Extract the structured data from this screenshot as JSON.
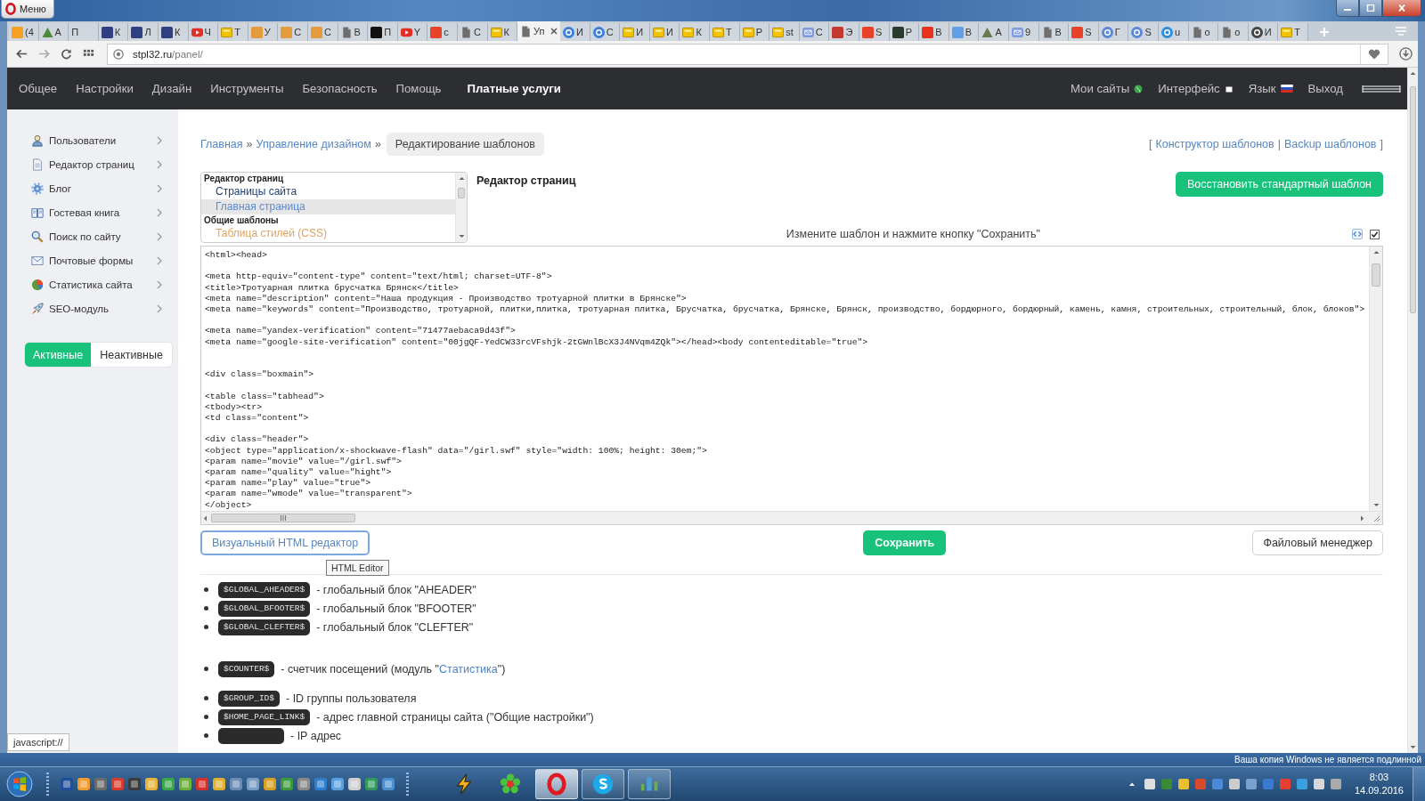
{
  "desktop": {
    "menu_button": "Меню",
    "notice": "Ваша копия Windows не является подлинной"
  },
  "browser": {
    "tabs": [
      {
        "title": "(4",
        "kind": "tile",
        "color": "#f5a021",
        "selected": false
      },
      {
        "title": "А",
        "kind": "triangle",
        "color": "#4f8a3c",
        "selected": false
      },
      {
        "title": "П",
        "kind": "none",
        "selected": false
      },
      {
        "title": "К",
        "kind": "tile",
        "color": "#2f3f7f",
        "selected": false
      },
      {
        "title": "Л",
        "kind": "tile",
        "color": "#2f3f7f",
        "selected": false
      },
      {
        "title": "К",
        "kind": "tile",
        "color": "#2f3f7f",
        "selected": false
      },
      {
        "title": "Ч",
        "kind": "play",
        "selected": false
      },
      {
        "title": "Т",
        "kind": "note",
        "selected": false
      },
      {
        "title": "У",
        "kind": "tile",
        "color": "#e39b3d",
        "selected": false
      },
      {
        "title": "С",
        "kind": "tile",
        "color": "#e39b3d",
        "selected": false
      },
      {
        "title": "С",
        "kind": "tile",
        "color": "#e39b3d",
        "selected": false
      },
      {
        "title": "В",
        "kind": "doc",
        "selected": false
      },
      {
        "title": "П",
        "kind": "tile",
        "color": "#111111",
        "selected": false
      },
      {
        "title": "Y",
        "kind": "play",
        "selected": false
      },
      {
        "title": "с",
        "kind": "tile",
        "color": "#e8412c",
        "selected": false
      },
      {
        "title": "С",
        "kind": "doc",
        "selected": false
      },
      {
        "title": "К",
        "kind": "note",
        "selected": false
      },
      {
        "title": "Уп",
        "kind": "doc",
        "selected": true
      },
      {
        "title": "И",
        "kind": "circle",
        "color": "#3d7fdb",
        "selected": false
      },
      {
        "title": "С",
        "kind": "circle",
        "color": "#3d7fdb",
        "selected": false
      },
      {
        "title": "И",
        "kind": "note",
        "selected": false
      },
      {
        "title": "И",
        "kind": "note",
        "selected": false
      },
      {
        "title": "К",
        "kind": "note",
        "selected": false
      },
      {
        "title": "Т",
        "kind": "note",
        "selected": false
      },
      {
        "title": "Р",
        "kind": "note",
        "selected": false
      },
      {
        "title": "st",
        "kind": "note",
        "selected": false
      },
      {
        "title": "С",
        "kind": "mail",
        "selected": false
      },
      {
        "title": "Э",
        "kind": "tile",
        "color": "#c43a2e",
        "selected": false
      },
      {
        "title": "S",
        "kind": "tile",
        "color": "#e8412c",
        "selected": false
      },
      {
        "title": "Р",
        "kind": "tile",
        "color": "#2b3a30",
        "selected": false
      },
      {
        "title": "В",
        "kind": "tile",
        "color": "#e8321e",
        "selected": false
      },
      {
        "title": "В",
        "kind": "tile",
        "color": "#5fa0e8",
        "selected": false
      },
      {
        "title": "А",
        "kind": "triangle",
        "color": "#6a7a50",
        "selected": false
      },
      {
        "title": "9",
        "kind": "mail",
        "selected": false
      },
      {
        "title": "В",
        "kind": "doc",
        "selected": false
      },
      {
        "title": "S",
        "kind": "tile",
        "color": "#e8412c",
        "selected": false
      },
      {
        "title": "Г",
        "kind": "circle",
        "color": "#5b87d8",
        "selected": false
      },
      {
        "title": "S",
        "kind": "circle",
        "color": "#5b87d8",
        "selected": false
      },
      {
        "title": "u",
        "kind": "circle",
        "color": "#2b8fe0",
        "selected": false
      },
      {
        "title": "о",
        "kind": "doc",
        "selected": false
      },
      {
        "title": "о",
        "kind": "doc",
        "selected": false
      },
      {
        "title": "И",
        "kind": "circle",
        "color": "#444444",
        "selected": false
      },
      {
        "title": "Т",
        "kind": "note",
        "selected": false
      }
    ],
    "address": {
      "host": "stpl32.ru",
      "path": "/panel/"
    },
    "status_url": "javascript://"
  },
  "nav": {
    "items": [
      {
        "label": "Общее",
        "highlighted": false
      },
      {
        "label": "Настройки",
        "highlighted": false
      },
      {
        "label": "Дизайн",
        "highlighted": false
      },
      {
        "label": "Инструменты",
        "highlighted": false
      },
      {
        "label": "Безопасность",
        "highlighted": false
      },
      {
        "label": "Помощь",
        "highlighted": false
      },
      {
        "label": "Платные услуги",
        "highlighted": true
      }
    ],
    "right": [
      {
        "label": "Мои сайты",
        "kind": "globe"
      },
      {
        "label": "Интерфейс",
        "kind": "square"
      },
      {
        "label": "Язык",
        "kind": "flag"
      },
      {
        "label": "Выход",
        "kind": "plain"
      }
    ]
  },
  "sidebar": {
    "items": [
      {
        "label": "Пользователи",
        "kind": "user"
      },
      {
        "label": "Редактор страниц",
        "kind": "page"
      },
      {
        "label": "Блог",
        "kind": "blog"
      },
      {
        "label": "Гостевая книга",
        "kind": "book"
      },
      {
        "label": "Поиск по сайту",
        "kind": "search"
      },
      {
        "label": "Почтовые формы",
        "kind": "mail"
      },
      {
        "label": "Статистика сайта",
        "kind": "chart"
      },
      {
        "label": "SEO-модуль",
        "kind": "rocket"
      }
    ],
    "filter": [
      {
        "label": "Активные",
        "selected": true
      },
      {
        "label": "Неактивные",
        "selected": false
      }
    ]
  },
  "breadcrumb": {
    "links": [
      "Главная",
      "Управление дизайном"
    ],
    "separator": "»",
    "current": "Редактирование шаблонов"
  },
  "template_links": {
    "open": "[",
    "links": [
      "Конструктор шаблонов",
      "Backup шаблонов"
    ],
    "divider": "|",
    "close": "]"
  },
  "template_list": {
    "groups": [
      {
        "label": "Редактор страниц",
        "options": [
          {
            "label": "Страницы сайта",
            "selected": false,
            "color": "#1f3f7a"
          },
          {
            "label": "Главная страница",
            "selected": true,
            "color": "#5b8bd0"
          }
        ]
      },
      {
        "label": "Общие шаблоны",
        "options": [
          {
            "label": "Таблица стилей (CSS)",
            "selected": false,
            "color": "#e0a45e"
          }
        ]
      }
    ]
  },
  "editor": {
    "title": "Редактор страниц",
    "restore_button": "Восстановить стандартный шаблон",
    "hint": "Измените шаблон и нажмите кнопку \"Сохранить\"",
    "wrap_checked": true,
    "code": "<html><head>\n\n<meta http-equiv=\"content-type\" content=\"text/html; charset=UTF-8\">\n<title>Тротуарная плитка брусчатка Брянск</title>\n<meta name=\"description\" content=\"Наша продукция - Производство тротуарной плитки в Брянске\">\n<meta name=\"keywords\" content=\"Производство, тротуарной, плитки,плитка, тротуарная плитка, Брусчатка, брусчатка, Брянске, Брянск, производство, бордюрного, бордюрный, камень, камня, строительных, строительный, блок, блоков\">\n\n<meta name=\"yandex-verification\" content=\"71477aebaca9d43f\">\n<meta name=\"google-site-verification\" content=\"00jgQF-YedCW33rcVFshjk-2tGWnlBcX3J4NVqm4ZQk\"></head><body contenteditable=\"true\">\n\n\n<div class=\"boxmain\">\n\n<table class=\"tabhead\">\n<tbody><tr>\n<td class=\"content\">\n\n<div class=\"header\">\n<object type=\"application/x-shockwave-flash\" data=\"/girl.swf\" style=\"width: 100%; height: 30em;\">\n<param name=\"movie\" value=\"/girl.swf\">\n<param name=\"quality\" value=\"hight\">\n<param name=\"play\" value=\"true\">\n<param name=\"wmode\" value=\"transparent\">\n</object>"
  },
  "actions": {
    "visual_button": "Визуальный HTML редактор",
    "save_button": "Сохранить",
    "files_button": "Файловый менеджер",
    "tooltip": "HTML Editor"
  },
  "variables": [
    {
      "items": [
        {
          "kind": "tag",
          "code": "$GLOBAL_AHEADER$",
          "text": "- глобальный блок \"AHEADER\""
        },
        {
          "kind": "tag",
          "code": "$GLOBAL_BFOOTER$",
          "text": "- глобальный блок \"BFOOTER\""
        },
        {
          "kind": "tag",
          "code": "$GLOBAL_CLEFTER$",
          "text": "- глобальный блок \"CLEFTER\""
        }
      ]
    },
    {
      "items": [
        {
          "kind": "tag",
          "code": "$COUNTER$",
          "text": "- счетчик посещений (модуль \"",
          "link": "Статистика",
          "after": "\")"
        }
      ]
    },
    {
      "items": [
        {
          "kind": "tag",
          "code": "$GROUP_ID$",
          "text": "- ID группы пользователя"
        },
        {
          "kind": "tag",
          "code": "$HOME_PAGE_LINK$",
          "text": "- адрес главной страницы сайта (\"Общие настройки\")"
        },
        {
          "kind": "blank-tag",
          "text": "- IP адрес"
        }
      ]
    }
  ],
  "taskbar": {
    "pinned": [
      {
        "kind": "lightning",
        "running": false,
        "selected": false
      },
      {
        "kind": "flower",
        "running": false,
        "selected": false
      },
      {
        "kind": "opera",
        "running": true,
        "selected": true
      },
      {
        "kind": "skype",
        "running": true,
        "selected": false
      },
      {
        "kind": "meter",
        "running": true,
        "selected": false
      }
    ],
    "time": "8:03",
    "date": "14.09.2016"
  }
}
